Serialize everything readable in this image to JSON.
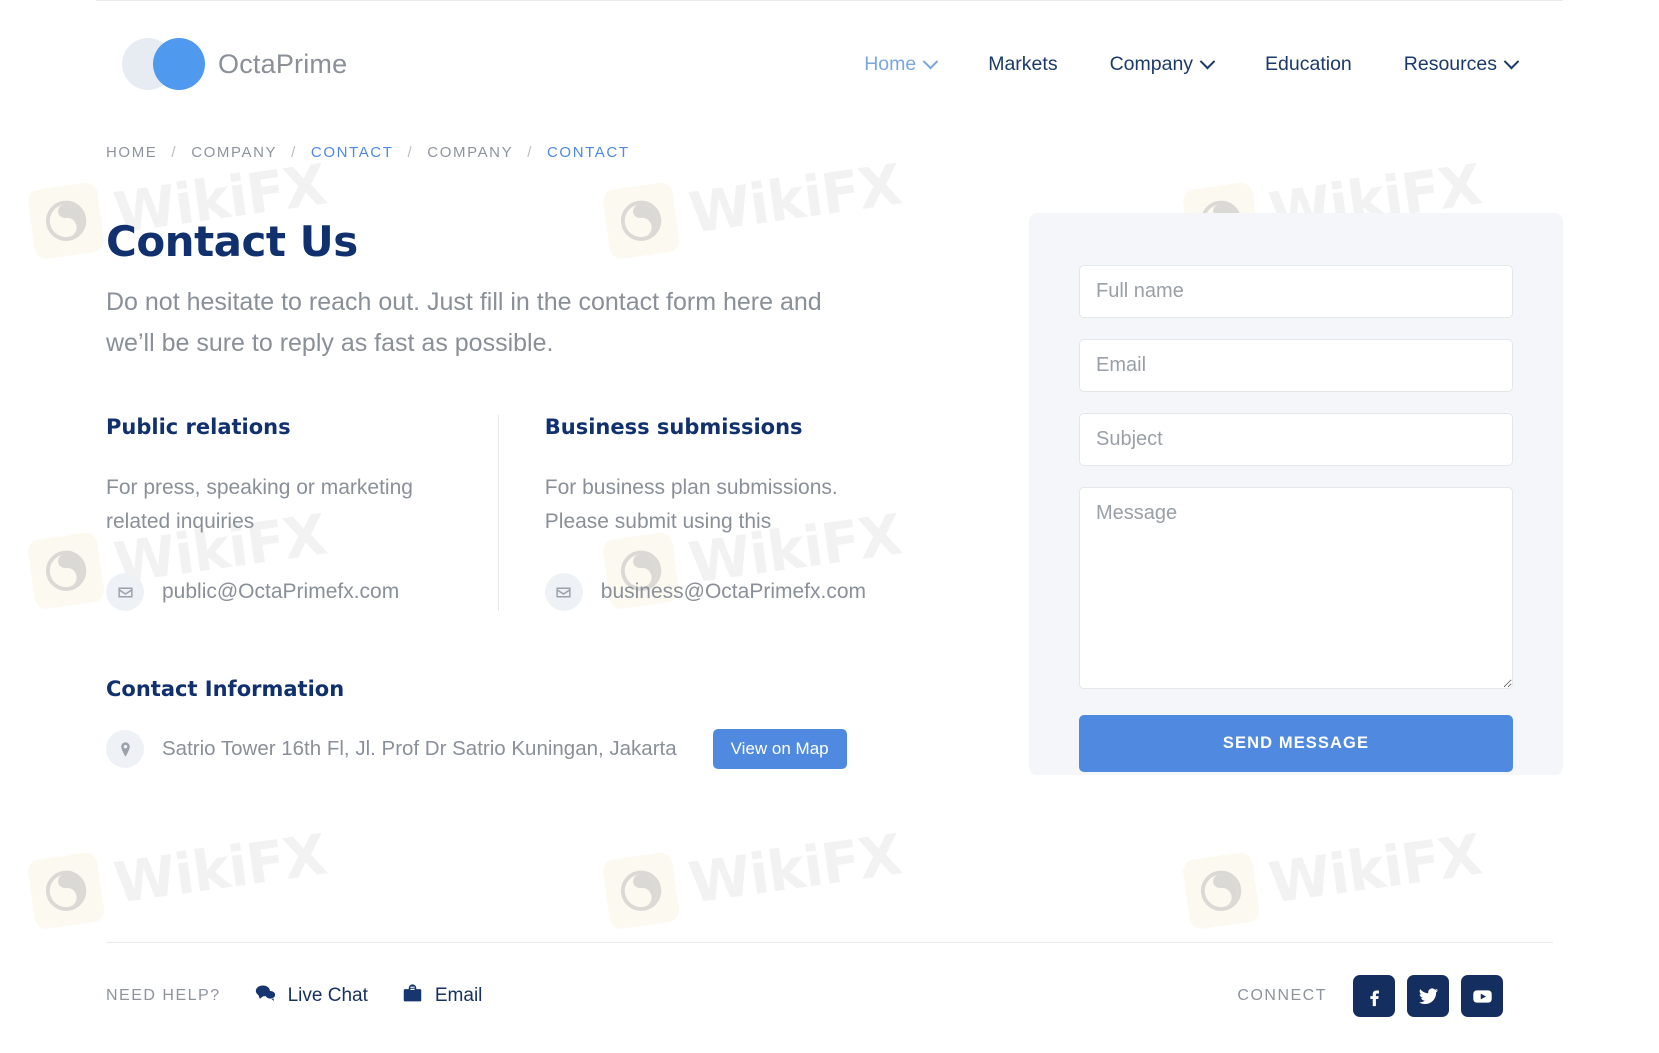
{
  "header": {
    "brand": {
      "name": "OctaPrime",
      "logo_icon": "two-circles-logo",
      "accent_color": "#4f9aee",
      "muted_color": "#e7ecf3"
    },
    "nav": [
      {
        "label": "Home",
        "has_caret": true,
        "active": true
      },
      {
        "label": "Markets",
        "has_caret": false,
        "active": false
      },
      {
        "label": "Company",
        "has_caret": true,
        "active": false
      },
      {
        "label": "Education",
        "has_caret": false,
        "active": false
      },
      {
        "label": "Resources",
        "has_caret": true,
        "active": false
      }
    ]
  },
  "breadcrumb": {
    "items": [
      {
        "label": "HOME",
        "link": false
      },
      {
        "label": "COMPANY",
        "link": false
      },
      {
        "label": "CONTACT",
        "link": true
      },
      {
        "label": "COMPANY",
        "link": false
      },
      {
        "label": "CONTACT",
        "link": true
      }
    ],
    "separator": "/"
  },
  "hero": {
    "title": "Contact Us",
    "subtitle": "Do not hesitate to reach out. Just fill in the contact form here and we’ll be sure to reply as fast as possible."
  },
  "columns": [
    {
      "title": "Public relations",
      "body": "For press, speaking or marketing related inquiries",
      "email": "public@OctaPrimefx.com",
      "icon": "envelope-icon"
    },
    {
      "title": "Business submissions",
      "body": "For business plan submissions. Please submit using this",
      "email": "business@OctaPrimefx.com",
      "icon": "envelope-icon"
    }
  ],
  "contact_information": {
    "title": "Contact Information",
    "address": "Satrio Tower 16th Fl, Jl. Prof Dr Satrio Kuningan, Jakarta",
    "map_button": "View on Map",
    "icon": "map-pin-icon"
  },
  "form": {
    "fields": [
      {
        "name": "full_name",
        "placeholder": "Full name",
        "value": ""
      },
      {
        "name": "email",
        "placeholder": "Email",
        "value": ""
      },
      {
        "name": "subject",
        "placeholder": "Subject",
        "value": ""
      }
    ],
    "message": {
      "placeholder": "Message",
      "value": ""
    },
    "submit_label": "SEND MESSAGE",
    "accent_color": "#4f8ae0",
    "panel_color": "#f4f6f9"
  },
  "footer": {
    "need_help_label": "NEED HELP?",
    "links": [
      {
        "label": "Live Chat",
        "icon": "chat-bubbles-icon"
      },
      {
        "label": "Email",
        "icon": "email-envelope-icon"
      }
    ],
    "connect_label": "CONNECT",
    "socials": [
      {
        "name": "facebook-icon"
      },
      {
        "name": "twitter-icon"
      },
      {
        "name": "youtube-icon"
      }
    ],
    "social_bg_color": "#152e60"
  },
  "watermark": {
    "text": "WikiFX"
  }
}
